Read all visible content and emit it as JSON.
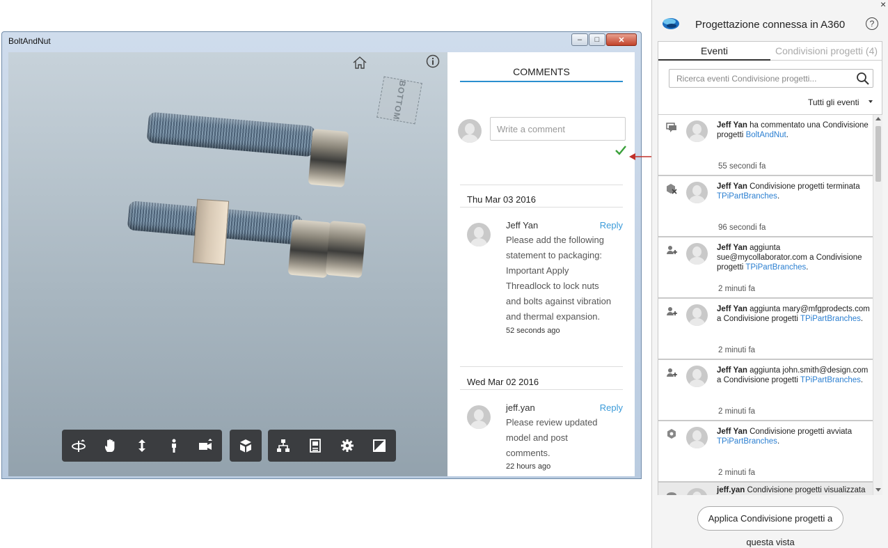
{
  "window": {
    "title": "BoltAndNut",
    "min_label": "–",
    "max_label": "□",
    "close_label": "✕"
  },
  "viewer": {
    "viewcube_face": "BOTTOM",
    "icons": {
      "home": "home-icon",
      "info": "info-icon",
      "toolbar": [
        "orbit-icon",
        "pan-icon",
        "zoom-icon",
        "walk-icon",
        "camera-icon",
        "explode-icon",
        "model-browser-icon",
        "properties-icon",
        "settings-icon",
        "fullscreen-icon"
      ]
    }
  },
  "comments": {
    "title": "COMMENTS",
    "input_placeholder": "Write a comment",
    "groups": [
      {
        "date": "Thu Mar 03 2016",
        "author": "Jeff Yan",
        "reply": "Reply",
        "lines": [
          "Please add the following",
          "statement to packaging:",
          "Important Apply",
          "Threadlock to lock nuts",
          "and bolts against vibration",
          "and thermal expansion."
        ],
        "time": "52 seconds ago"
      },
      {
        "date": "Wed Mar 02 2016",
        "author": "jeff.yan",
        "reply": "Reply",
        "lines": [
          "Please review updated",
          "model and post",
          "comments."
        ],
        "time": "22 hours ago"
      }
    ]
  },
  "panel": {
    "close": "×",
    "title": "Progettazione connessa in A360",
    "help": "?",
    "tabs": {
      "events": "Eventi",
      "shares": "Condivisioni progetti (4)"
    },
    "search_placeholder": "Ricerca eventi Condivisione progetti...",
    "filter": "Tutti gli eventi",
    "events": [
      {
        "icon": "comment-icon",
        "name": "Jeff Yan",
        "text": " ha commentato una Condivisione progetti ",
        "link": "BoltAndNut",
        "end": ".",
        "time": "55 secondi fa"
      },
      {
        "icon": "share-ended-icon",
        "name": "Jeff Yan",
        "text": " Condivisione progetti terminata ",
        "link": "TPiPartBranches",
        "end": ".",
        "time": "96 secondi fa"
      },
      {
        "icon": "add-user-icon",
        "name": "Jeff Yan",
        "text": " aggiunta sue@mycollaborator.com a Condivisione progetti ",
        "link": "TPiPartBranches",
        "end": ".",
        "time": "2 minuti fa"
      },
      {
        "icon": "add-user-icon",
        "name": "Jeff Yan",
        "text": " aggiunta mary@mfgprodects.com a Condivisione progetti ",
        "link": "TPiPartBranches",
        "end": ".",
        "time": "2 minuti fa"
      },
      {
        "icon": "add-user-icon",
        "name": "Jeff Yan",
        "text": " aggiunta john.smith@design.com a Condivisione progetti ",
        "link": "TPiPartBranches",
        "end": ".",
        "time": "2 minuti fa"
      },
      {
        "icon": "share-started-icon",
        "name": "Jeff Yan",
        "text": " Condivisione progetti avviata ",
        "link": "TPiPartBranches",
        "end": ".",
        "time": "2 minuti fa"
      },
      {
        "icon": "share-viewed-icon",
        "name": "jeff.yan",
        "text": " Condivisione progetti visualizzata",
        "link": "",
        "end": "",
        "time": ""
      }
    ],
    "apply_button": "Applica Condivisione progetti a",
    "apply_button_line2": "questa vista",
    "colors": {
      "link": "#2b7fd1",
      "accent": "#2a8fcf",
      "check": "#3aa03a",
      "arrow": "#c0302a"
    }
  }
}
